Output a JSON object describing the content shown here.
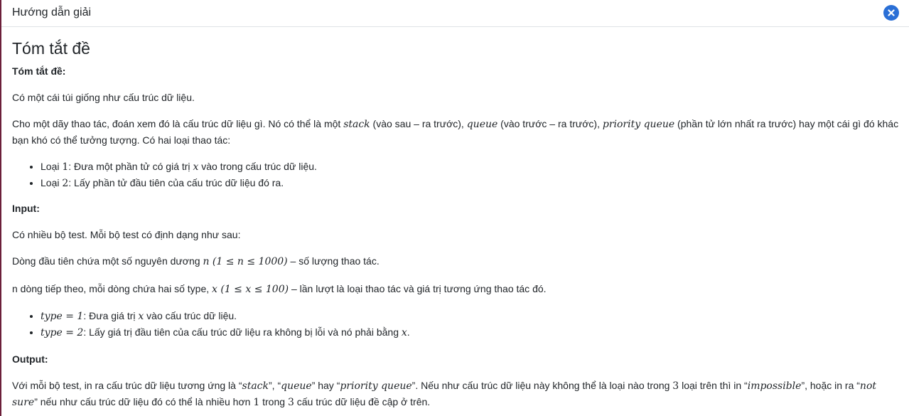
{
  "dialog": {
    "title": "Hướng dẫn giải"
  },
  "heading": "Tóm tắt đề",
  "summary": {
    "label": "Tóm tắt đề:",
    "p1": "Có một cái túi giống như cấu trúc dữ liệu.",
    "p2": {
      "a": "Cho một dãy thao tác, đoán xem đó là cấu trúc dữ liệu gì. Nó có thể là một ",
      "stack": "stack",
      "b": " (vào sau – ra trước), ",
      "queue": "queue",
      "c": " (vào trước – ra trước), ",
      "pq": "priority queue",
      "d": " (phần tử lớn nhất ra trước) hay một cái gì đó khác bạn khó có thể tưởng tượng. Có hai loại thao tác:"
    },
    "items": [
      {
        "pre": "Loại ",
        "num": "1",
        "mid": ": Đưa một phần tử có giá trị ",
        "var": "x",
        "post": " vào trong cấu trúc dữ liệu."
      },
      {
        "pre": "Loại ",
        "num": "2",
        "mid": ": Lấy phần tử đầu tiên của cấu trúc dữ liệu đó ra.",
        "var": "",
        "post": ""
      }
    ]
  },
  "input": {
    "label": "Input:",
    "p1": "Có nhiều bộ test. Mỗi bộ test có định dạng như sau:",
    "p2": {
      "a": "Dòng đầu tiên chứa một số nguyên dương ",
      "math": "n (1 ≤ n ≤ 1000)",
      "b": " – số lượng thao tác."
    },
    "p3": {
      "a": "n dòng tiếp theo, mỗi dòng chứa hai số type, ",
      "math": "x (1 ≤ x ≤ 100)",
      "b": " – lần lượt là loại thao tác và giá trị tương ứng thao tác đó."
    },
    "items": [
      {
        "math": "type = 1",
        "a": ": Đưa giá trị ",
        "var": "x",
        "b": " vào cấu trúc dữ liệu."
      },
      {
        "math": "type = 2",
        "a": ": Lấy giá trị đầu tiên của cấu trúc dữ liệu ra không bị lỗi và nó phải bằng ",
        "var": "x",
        "b": "."
      }
    ]
  },
  "output": {
    "label": "Output:",
    "a": "Với mỗi bộ test, in ra cấu trúc dữ liệu tương ứng là “",
    "stack": "stack",
    "b": "”, “",
    "queue": "queue",
    "c": "” hay “",
    "pq": "priority queue",
    "d": "”. Nếu như cấu trúc dữ liệu này không thể là loại nào trong ",
    "n3": "3",
    "e": " loại trên thì in “",
    "imp": "impossible",
    "f": "”, hoặc in ra “",
    "ns": "not sure",
    "g": "” nếu như cấu trúc dữ liệu đó có thể là nhiều hơn ",
    "n1": "1",
    "h": " trong ",
    "n3b": "3",
    "i": " cấu trúc dữ liệu đề cập ở trên."
  }
}
